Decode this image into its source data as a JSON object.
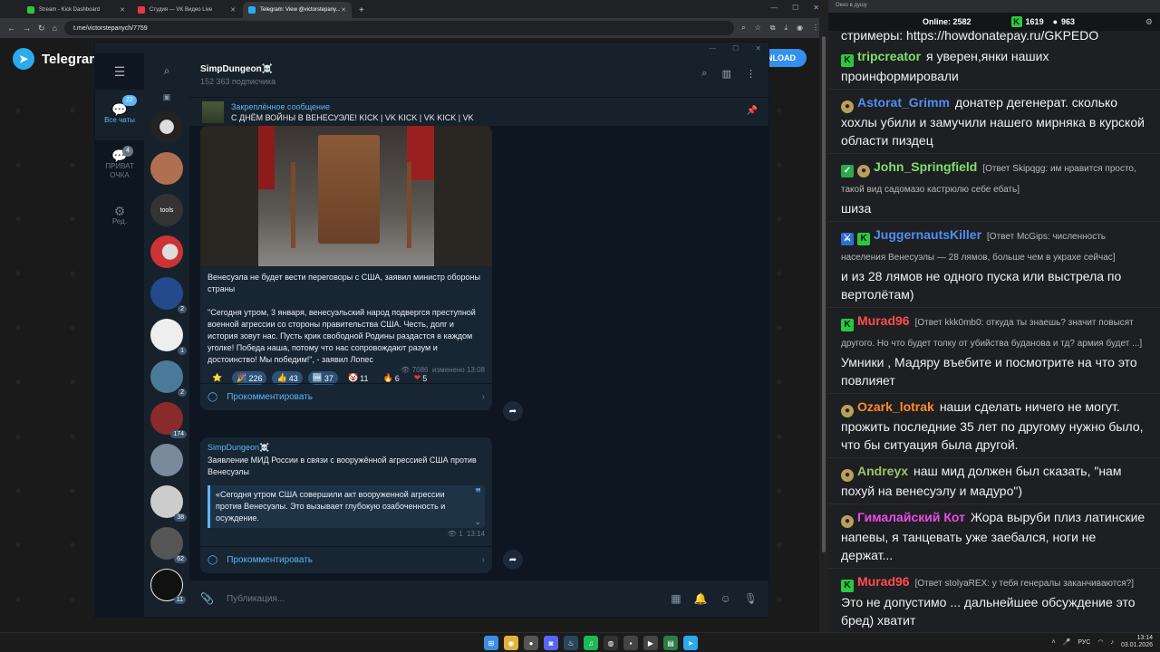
{
  "browser": {
    "tabs": [
      {
        "label": "Stream - Kick Dashboard",
        "color": "#28c93d"
      },
      {
        "label": "Студия — VK Видео Live",
        "color": "#e63946"
      },
      {
        "label": "Telegram: View @victorstepany...",
        "color": "#2aabee"
      }
    ],
    "new_tab": "+",
    "url": "t.me/victorstepanych/7759"
  },
  "telegram_page": {
    "logo": "Telegram",
    "download": "NLOAD"
  },
  "tg": {
    "folders": [
      {
        "label": "Все чаты",
        "badge": "22",
        "icon": "💬"
      },
      {
        "label": "ПРИВАТ\nОЧКА",
        "badge": "4",
        "icon": "💬"
      },
      {
        "label": "Ред.",
        "badge": "",
        "icon": "⚙"
      }
    ],
    "chat_badges": [
      "2",
      "1",
      "2",
      "174",
      "38",
      "62",
      "11"
    ],
    "channel": {
      "name": "SimpDungeon☠️",
      "subs": "152 363 подписчика"
    },
    "pinned": {
      "label": "Закреплённое сообщение",
      "text": "С ДНЁМ ВОЙНЫ В ВЕНЕСУЭЛЕ!  KICK | VK KICK | VK KICK | VK"
    },
    "post1": {
      "text": "Венесуэла не будет вести переговоры с США, заявил министр обороны страны\n\n\"Сегодня утром, 3 января, венесуэльский народ подвергся преступной военной агрессии со стороны правительства США. Честь, долг и история зовут нас. Пусть крик свободной Родины раздастся в каждом уголке! Победа наша, потому что нас сопровождают разум и достоинство! Мы победим!\", - заявил Лопес",
      "reactions": [
        {
          "emoji": "⭐",
          "count": ""
        },
        {
          "emoji": "🎉",
          "count": "226"
        },
        {
          "emoji": "👍",
          "count": "43"
        },
        {
          "emoji": "🆓",
          "count": "37"
        },
        {
          "emoji": "🤡",
          "count": "11"
        },
        {
          "emoji": "🔥",
          "count": "6"
        },
        {
          "emoji": "❤",
          "count": "5"
        }
      ],
      "views": "7086",
      "edited": "изменено 13:08",
      "comment": "Прокомментировать"
    },
    "post2": {
      "author": "SimpDungeon☠️",
      "text": "Заявление МИД России в связи с вооружённой агрессией США против Венесуэлы",
      "quote": "«Сегодня утром США совершили акт вооруженной агрессии против Венесуэлы. Это вызывает глубокую озабоченность и осуждение.",
      "views": "1",
      "time": "13:14",
      "comment": "Прокомментировать"
    },
    "composer_placeholder": "Публикация..."
  },
  "chat": {
    "title": "Окно в душу",
    "online_label": "Online:",
    "online": "2582",
    "kick_count": "1619",
    "vk_count": "963",
    "top_cut": "стримеры: https://howdonatepay.ru/GKPEDO",
    "messages": [
      {
        "user": "tripcreator",
        "color": "#7ee06a",
        "badges": [
          "kick"
        ],
        "reply": "",
        "text": "я уверен,янки наших проинформировали"
      },
      {
        "user": "Astorat_Grimm",
        "color": "#4f8ef0",
        "badges": [
          "head"
        ],
        "reply": "",
        "text": "донатер дегенерат. сколько хохлы убили и замучили нашего мирняка в курской области пиздец"
      },
      {
        "user": "John_Springfield",
        "color": "#7ee06a",
        "badges": [
          "sub",
          "head"
        ],
        "reply": "[Ответ Skipqgg: им нравится просто, такой вид садомазо кастрюлю себе ебать]",
        "text": "шиза"
      },
      {
        "user": "JuggernautsKiller",
        "color": "#4f8ef0",
        "badges": [
          "sword",
          "kick"
        ],
        "reply": "[Ответ McGips: численность населения Венесуэлы — 28 лямов, больше чем в украхе сейчас]",
        "text": "и из 28 лямов не одного пуска или выстрела по вертолётам)"
      },
      {
        "user": "Murad96",
        "color": "#ff4d4d",
        "badges": [
          "kick"
        ],
        "reply": "[Ответ kkk0mb0: откуда ты знаешь? значит повысят другого. Но что будет толку от убийства буданова и тд? армия будет ...]",
        "text": "Умники , Мадяру въебите и посмотрите на что это повлияет"
      },
      {
        "user": "Ozark_lotrak",
        "color": "#ff8a2a",
        "badges": [
          "head"
        ],
        "reply": "",
        "text": "наши сделать ничего не могут. прожить последние 35 лет по другому нужно было, что бы ситуация была другой."
      },
      {
        "user": "Andreyx",
        "color": "#9fc26a",
        "badges": [
          "head"
        ],
        "reply": "",
        "text": "наш мид должен был сказать, \"нам похуй на венесуэлу и мадуро\")"
      },
      {
        "user": "Гималайский Кот",
        "color": "#e84de8",
        "badges": [
          "head"
        ],
        "reply": "",
        "text": "Жора выруби плиз латинские напевы, я танцевать уже заебался, ноги не держат..."
      },
      {
        "user": "Murad96",
        "color": "#ff4d4d",
        "badges": [
          "kick"
        ],
        "reply": "[Ответ stolyaREX: у тебя генералы заканчиваются?]",
        "text": "Это не допустимо ... дальнейшее обсуждение это бред) хватит"
      }
    ]
  },
  "taskbar": {
    "lang": "РУС",
    "time": "13:14",
    "date": "03.01.2026"
  }
}
